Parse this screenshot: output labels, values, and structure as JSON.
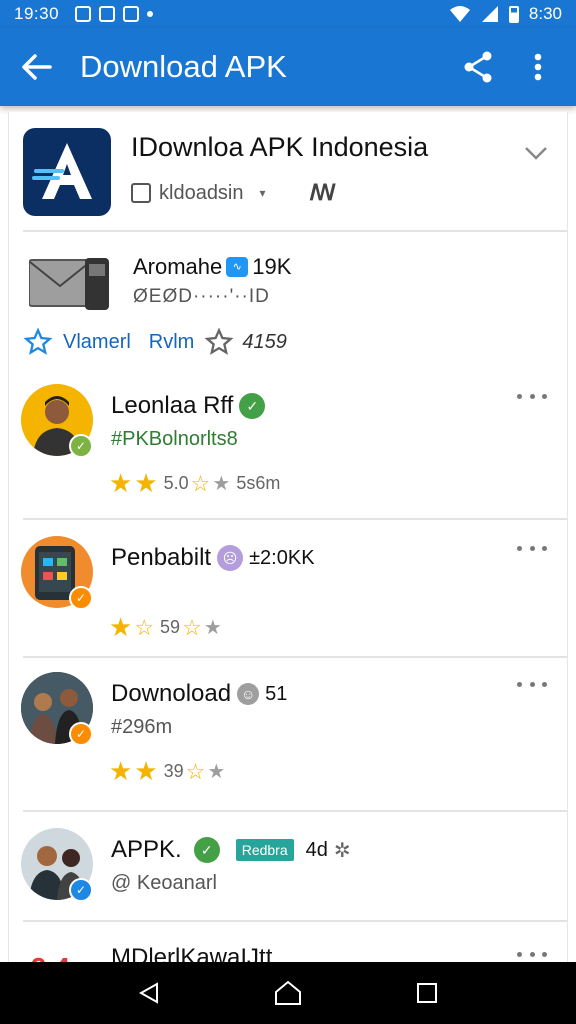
{
  "status_bar": {
    "time": "19:30",
    "clock_right": "8:30",
    "icons": [
      "notification-icon",
      "image-icon",
      "gallery-icon",
      "wifi-icon",
      "signal-icon",
      "battery-icon"
    ]
  },
  "appbar": {
    "title": "Download APK",
    "color": "#1976d2",
    "icons": [
      "back-arrow-icon",
      "share-icon",
      "more-vert-icon"
    ]
  },
  "app": {
    "title": "IDownloa APK Indonesia",
    "developer": "kldoadsin",
    "developer_caret": "▾",
    "extra_glyph": "ꟿ"
  },
  "featured": {
    "title": "Aromahe",
    "badge": "∿",
    "count": "19K",
    "subtitle": "ØEØD·····'··ID"
  },
  "rating_row": {
    "label_1": "Vlamerl",
    "label_2": "Rvlm",
    "count": "4159"
  },
  "users": [
    {
      "name": "Leonlaa Rff",
      "subtitle": "#PKBolnorlts8",
      "subtitle_color": "#2e7d32",
      "stars_text_1": "5.0",
      "stars_text_2": "5s6m",
      "verified_color": "#43a047",
      "avatar_badge_color": "#7cb342"
    },
    {
      "name": "Penbabilt",
      "extra": "±2:0ΚK",
      "stars_text_1": "59",
      "verified_color": "#b39ddb",
      "avatar_badge_color": "#fb8c00"
    },
    {
      "name": "Downoload",
      "extra": "51",
      "subtitle": "#296m",
      "subtitle_color": "#555555",
      "stars_text_1": "39",
      "verified_color": "#9e9e9e",
      "avatar_badge_color": "#fb8c00"
    },
    {
      "name": "APPK.",
      "tag": "Redbra",
      "extra": "4d",
      "subtitle": "@ Keoanarl",
      "subtitle_color": "#555555",
      "verified_color": "#43a047",
      "avatar_badge_color": "#1e88e5"
    },
    {
      "name": "MDlerlKawaIJtt"
    }
  ]
}
